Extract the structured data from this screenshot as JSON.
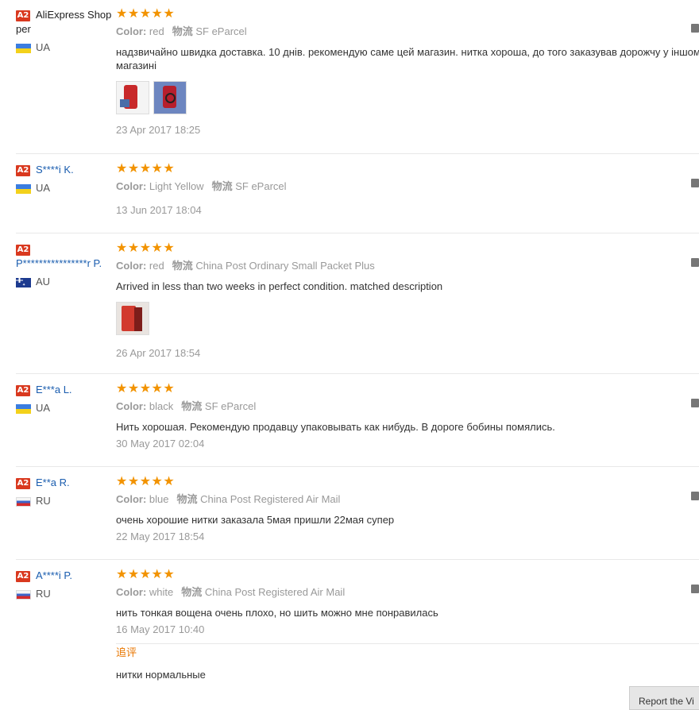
{
  "badge_label": "A2",
  "stars": "★★★★★",
  "color_label": "Color:",
  "logistics_label": "物流",
  "reviews": [
    {
      "user": "AliExpress Shopper",
      "country": "UA",
      "color": "red",
      "shipping": "SF eParcel",
      "text": "надзвичайно швидка доставка. 10 днів. рекомендую саме цей магазин. нитка хороша, до того заказував дорожчу у іншому магазині",
      "date": "23 Apr 2017 18:25"
    },
    {
      "user": "S****i K.",
      "country": "UA",
      "color": "Light Yellow",
      "shipping": "SF eParcel",
      "date": "13 Jun 2017 18:04"
    },
    {
      "user": "P****************r P.",
      "country": "AU",
      "color": "red",
      "shipping": "China Post Ordinary Small Packet Plus",
      "text": "Arrived in less than two weeks in perfect condition. matched description",
      "date": "26 Apr 2017 18:54"
    },
    {
      "user": "E***a L.",
      "country": "UA",
      "color": "black",
      "shipping": "SF eParcel",
      "text": "Нить хорошая. Рекомендую продавцу упаковывать как нибудь. В дороге бобины помялись.",
      "date": "30 May 2017 02:04"
    },
    {
      "user": "E**a R.",
      "country": "RU",
      "color": "blue",
      "shipping": "China Post Registered Air Mail",
      "text": "очень хорошие нитки заказала 5мая пришли 22мая супер",
      "date": "22 May 2017 18:54"
    },
    {
      "user": "A****i P.",
      "country": "RU",
      "color": "white",
      "shipping": "China Post Registered Air Mail",
      "text": "нить тонкая вощена очень плохо, но шить можно мне понравилась",
      "date": "16 May 2017 10:40",
      "additional_label": "追评",
      "additional_text": "нитки нормальные"
    }
  ],
  "view_button": "Report the Vi"
}
